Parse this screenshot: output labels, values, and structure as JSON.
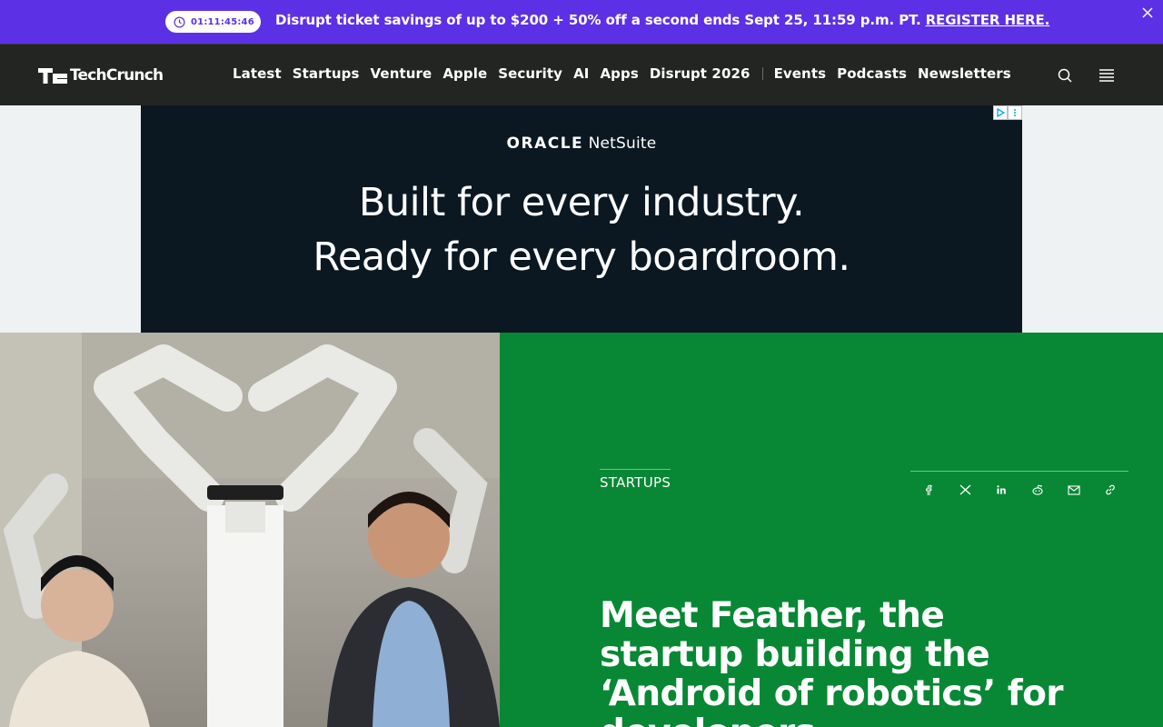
{
  "promo": {
    "countdown": "01:11:45:46",
    "text": "Disrupt ticket savings of up to $200 + 50% off a second ends Sept 25, 11:59 p.m. PT.",
    "link": "REGISTER HERE."
  },
  "header": {
    "logo_text": "TechCrunch",
    "nav_primary": [
      "Latest",
      "Startups",
      "Venture",
      "Apple",
      "Security",
      "AI",
      "Apps",
      "Disrupt 2026"
    ],
    "nav_secondary": [
      "Events",
      "Podcasts",
      "Newsletters"
    ]
  },
  "ad": {
    "brand_oracle": "ORACLE",
    "brand_product": "NetSuite",
    "line1": "Built for every industry.",
    "line2": "Ready for every boardroom."
  },
  "article": {
    "category": "STARTUPS",
    "headline": "Meet Feather, the startup building the ‘Android of robotics’ for developers",
    "share_icons": [
      "facebook-icon",
      "x-icon",
      "linkedin-icon",
      "reddit-icon",
      "email-icon",
      "link-icon"
    ]
  },
  "colors": {
    "promo_bg": "#5c31e6",
    "header_bg": "#232522",
    "ad_bg": "#0b1821",
    "article_bg": "#088834"
  }
}
